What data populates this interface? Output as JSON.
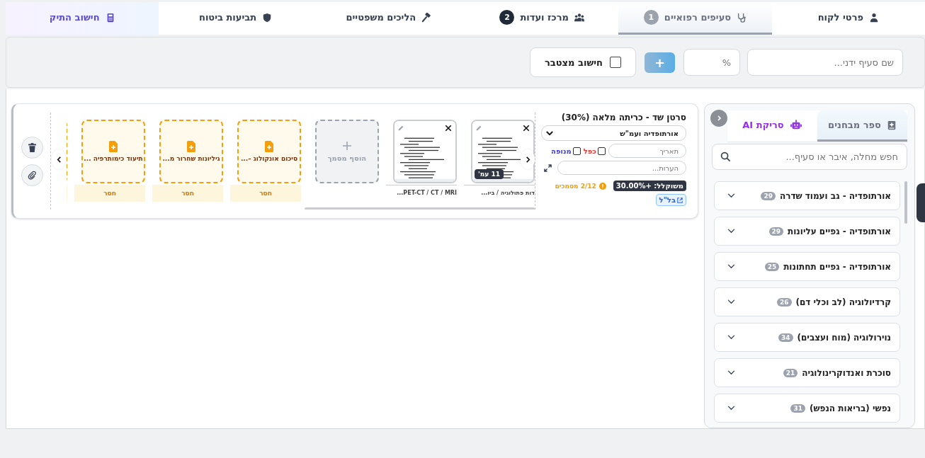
{
  "tabs": [
    {
      "label": "פרטי לקוח",
      "kind": "client",
      "selected": false
    },
    {
      "label": "סעיפים רפואיים",
      "kind": "medical",
      "badge": "1",
      "selected": true
    },
    {
      "label": "מרכז ועדות",
      "kind": "committee",
      "badge": "2",
      "selected": false
    },
    {
      "label": "הליכים משפטיים",
      "kind": "legal",
      "selected": false
    },
    {
      "label": "תביעות ביטוח",
      "kind": "insurance",
      "selected": false
    },
    {
      "label": "חישוב התיק",
      "kind": "calc",
      "selected": false
    }
  ],
  "toolbar": {
    "name_placeholder": "שם סעיף ידני...",
    "percent_placeholder": "%",
    "add_button": "+",
    "cumulative": {
      "label": "חישוב מצטבר",
      "checked": false
    }
  },
  "item": {
    "title": "סרטן שד - כריתה מלאה (30%)",
    "category": "אורתופדיה ועמ\"ש",
    "date_placeholder": "תאריך",
    "flags": [
      {
        "label": "כפל",
        "checked": false,
        "color": "#e53935"
      },
      {
        "label": "מנופה",
        "checked": false,
        "color": "#3f3fd1"
      }
    ],
    "notes_placeholder": "הערות...",
    "weighted": "משוקלל: +30.00%",
    "docs_count": "2/12 מסמכים",
    "link": "בל\"ל",
    "documents": [
      {
        "kind": "document",
        "caption": "דות פתולוגיה / ביו...",
        "pages": "11 עמ'"
      },
      {
        "kind": "document",
        "caption": "PET-CT / CT / MRI..."
      },
      {
        "kind": "add",
        "label": "הוסף מסמך"
      },
      {
        "kind": "missing",
        "title": "סיכום אונקולוג –...",
        "status": "חסר"
      },
      {
        "kind": "missing",
        "title": "גיליונות שחרור מ...",
        "status": "חסר"
      },
      {
        "kind": "missing",
        "title": "תיעוד כימותרפיה ...",
        "status": "חסר"
      },
      {
        "kind": "missing_partial"
      }
    ]
  },
  "sidebar": {
    "tabs": [
      {
        "label": "ספר מבחנים",
        "kind": "book",
        "selected": true
      },
      {
        "label": "סריקת AI",
        "kind": "ai",
        "selected": false
      }
    ],
    "search_placeholder": "חפש מחלה, איבר או סעיף...",
    "categories": [
      {
        "label": "אורתופדיה - גב ועמוד שדרה",
        "count": "29"
      },
      {
        "label": "אורתופדיה - גפיים עליונות",
        "count": "29"
      },
      {
        "label": "אורתופדיה - גפיים תחתונות",
        "count": "25"
      },
      {
        "label": "קרדיולוגיה (לב וכלי דם)",
        "count": "26"
      },
      {
        "label": "נוירולוגיה (מוח ועצבים)",
        "count": "34"
      },
      {
        "label": "סוכרת ואנדוקרינולוגיה",
        "count": "21"
      },
      {
        "label": "נפשי (בריאות הנפש)",
        "count": "31"
      }
    ]
  }
}
